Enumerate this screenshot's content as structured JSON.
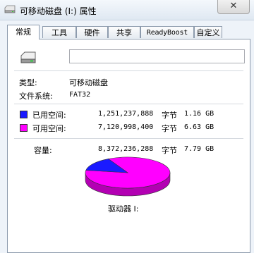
{
  "window": {
    "title": "可移动磁盘 (I:) 属性",
    "close_glyph": "✕"
  },
  "tabs": [
    {
      "label": "常规",
      "active": true
    },
    {
      "label": "工具"
    },
    {
      "label": "硬件"
    },
    {
      "label": "共享"
    },
    {
      "label": "ReadyBoost"
    },
    {
      "label": "自定义"
    }
  ],
  "general": {
    "name_value": "",
    "type_label": "类型:",
    "type_value": "可移动磁盘",
    "fs_label": "文件系统:",
    "fs_value": "FAT32",
    "used": {
      "label": "已用空间:",
      "bytes": "1,251,237,888",
      "unit": "字节",
      "size": "1.16 GB",
      "color": "#1a1aff",
      "fraction": 0.1494
    },
    "free": {
      "label": "可用空间:",
      "bytes": "7,120,998,400",
      "unit": "字节",
      "size": "6.63 GB",
      "color": "#ff00ff",
      "fraction": 0.8506
    },
    "capacity": {
      "label": "容量:",
      "bytes": "8,372,236,288",
      "unit": "字节",
      "size": "7.79 GB"
    },
    "drive_label": "驱动器 I:"
  }
}
